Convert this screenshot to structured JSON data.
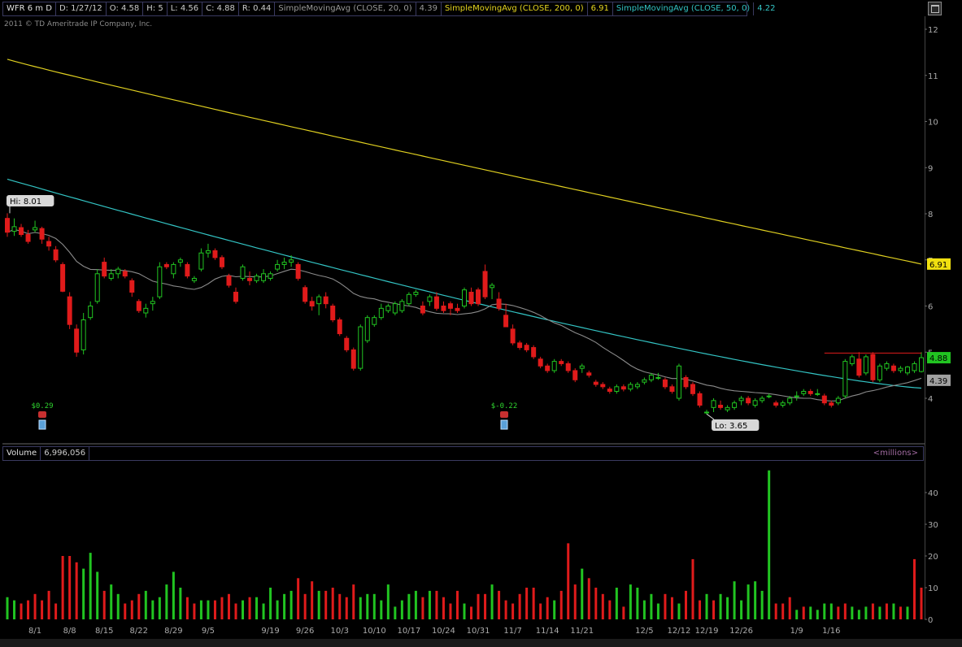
{
  "header": {
    "symbol": "WFR 6 m D",
    "date": "D: 1/27/12",
    "open": "O: 4.58",
    "high": "H: 5",
    "low": "L: 4.56",
    "close": "C: 4.88",
    "range": "R: 0.44",
    "sma20_label": "SimpleMovingAvg (CLOSE, 20, 0)",
    "sma20_value": "4.39",
    "sma200_label": "SimpleMovingAvg (CLOSE, 200, 0)",
    "sma200_value": "6.91",
    "sma50_label": "SimpleMovingAvg (CLOSE, 50, 0)",
    "sma50_value": "4.22"
  },
  "copyright": "2011 © TD Ameritrade IP Company, Inc.",
  "volume_header": {
    "label": "Volume",
    "value": "6,996,056",
    "units": "<millions>"
  },
  "colors": {
    "up": "#21c421",
    "down": "#e01b1b",
    "sma20": "#8a8a8a",
    "sma50": "#33c4c4",
    "sma200": "#e0d020",
    "neutral": "#b0b0b0"
  },
  "chart_data": [
    {
      "type": "candlestick",
      "title": "WFR 6 m D",
      "ylim": [
        3.2,
        12.3
      ],
      "y_ticks": [
        4,
        5,
        6,
        7,
        8,
        9,
        10,
        11,
        12
      ],
      "x_labels": [
        "8/1",
        "8/8",
        "8/15",
        "8/22",
        "8/29",
        "9/5",
        "9/19",
        "9/26",
        "10/3",
        "10/10",
        "10/17",
        "10/24",
        "10/31",
        "11/7",
        "11/14",
        "11/21",
        "12/5",
        "12/12",
        "12/19",
        "12/26",
        "1/9",
        "1/16"
      ],
      "x_label_index": [
        4,
        9,
        14,
        19,
        24,
        29,
        38,
        43,
        48,
        53,
        58,
        63,
        68,
        73,
        78,
        83,
        92,
        97,
        101,
        106,
        114,
        119
      ],
      "ohlc": [
        [
          7.9,
          8.01,
          7.5,
          7.6
        ],
        [
          7.62,
          7.9,
          7.52,
          7.72
        ],
        [
          7.7,
          7.78,
          7.5,
          7.55
        ],
        [
          7.55,
          7.65,
          7.35,
          7.4
        ],
        [
          7.65,
          7.85,
          7.6,
          7.7
        ],
        [
          7.68,
          7.72,
          7.35,
          7.45
        ],
        [
          7.4,
          7.5,
          7.2,
          7.3
        ],
        [
          7.22,
          7.3,
          6.95,
          7.0
        ],
        [
          6.9,
          6.95,
          6.3,
          6.32
        ],
        [
          6.2,
          6.3,
          5.5,
          5.6
        ],
        [
          5.5,
          5.6,
          4.9,
          5.0
        ],
        [
          5.05,
          5.85,
          4.95,
          5.7
        ],
        [
          5.75,
          6.1,
          5.7,
          6.0
        ],
        [
          6.1,
          6.8,
          6.05,
          6.7
        ],
        [
          6.95,
          7.05,
          6.6,
          6.65
        ],
        [
          6.6,
          6.8,
          6.55,
          6.7
        ],
        [
          6.7,
          6.85,
          6.6,
          6.8
        ],
        [
          6.75,
          6.8,
          6.6,
          6.65
        ],
        [
          6.55,
          6.6,
          6.2,
          6.3
        ],
        [
          6.1,
          6.15,
          5.85,
          5.9
        ],
        [
          5.85,
          6.05,
          5.75,
          5.95
        ],
        [
          6.05,
          6.2,
          5.9,
          6.1
        ],
        [
          6.2,
          6.95,
          6.15,
          6.85
        ],
        [
          6.9,
          6.95,
          6.8,
          6.85
        ],
        [
          6.7,
          6.95,
          6.6,
          6.9
        ],
        [
          6.95,
          7.05,
          6.85,
          7.0
        ],
        [
          6.9,
          6.95,
          6.6,
          6.65
        ],
        [
          6.55,
          6.65,
          6.5,
          6.6
        ],
        [
          6.8,
          7.25,
          6.75,
          7.15
        ],
        [
          7.15,
          7.35,
          7.05,
          7.2
        ],
        [
          7.2,
          7.25,
          7.0,
          7.05
        ],
        [
          7.05,
          7.1,
          6.8,
          6.85
        ],
        [
          6.65,
          6.7,
          6.4,
          6.45
        ],
        [
          6.3,
          6.4,
          6.05,
          6.1
        ],
        [
          6.6,
          6.9,
          6.55,
          6.85
        ],
        [
          6.6,
          6.75,
          6.45,
          6.55
        ],
        [
          6.55,
          6.7,
          6.5,
          6.65
        ],
        [
          6.55,
          6.8,
          6.5,
          6.7
        ],
        [
          6.6,
          6.75,
          6.55,
          6.7
        ],
        [
          6.8,
          7.0,
          6.75,
          6.9
        ],
        [
          6.9,
          7.05,
          6.8,
          6.95
        ],
        [
          6.95,
          7.1,
          6.85,
          7.0
        ],
        [
          6.9,
          6.95,
          6.55,
          6.6
        ],
        [
          6.4,
          6.45,
          6.05,
          6.1
        ],
        [
          6.1,
          6.2,
          5.9,
          6.0
        ],
        [
          6.05,
          6.25,
          5.8,
          6.2
        ],
        [
          6.2,
          6.3,
          5.95,
          6.05
        ],
        [
          6.0,
          6.05,
          5.65,
          5.7
        ],
        [
          5.7,
          5.75,
          5.35,
          5.4
        ],
        [
          5.3,
          5.35,
          5.0,
          5.05
        ],
        [
          5.05,
          5.1,
          4.6,
          4.65
        ],
        [
          4.65,
          5.6,
          4.6,
          5.55
        ],
        [
          5.25,
          5.8,
          5.2,
          5.75
        ],
        [
          5.6,
          5.8,
          5.55,
          5.75
        ],
        [
          5.75,
          6.05,
          5.7,
          5.95
        ],
        [
          5.9,
          6.05,
          5.85,
          6.0
        ],
        [
          5.85,
          6.1,
          5.8,
          6.05
        ],
        [
          5.9,
          6.15,
          5.85,
          6.1
        ],
        [
          6.05,
          6.3,
          6.0,
          6.25
        ],
        [
          6.25,
          6.35,
          6.2,
          6.3
        ],
        [
          6.0,
          6.1,
          5.8,
          5.85
        ],
        [
          6.1,
          6.25,
          6.0,
          6.2
        ],
        [
          6.2,
          6.3,
          5.9,
          5.95
        ],
        [
          6.0,
          6.1,
          5.85,
          5.9
        ],
        [
          6.05,
          6.1,
          5.8,
          5.95
        ],
        [
          5.95,
          6.05,
          5.85,
          5.9
        ],
        [
          6.0,
          6.4,
          5.95,
          6.35
        ],
        [
          6.3,
          6.4,
          6.0,
          6.05
        ],
        [
          6.35,
          6.4,
          6.0,
          6.05
        ],
        [
          6.75,
          6.9,
          6.15,
          6.2
        ],
        [
          6.4,
          6.5,
          6.15,
          6.45
        ],
        [
          6.15,
          6.3,
          5.9,
          5.95
        ],
        [
          5.8,
          6.05,
          5.55,
          5.55
        ],
        [
          5.5,
          5.6,
          5.15,
          5.2
        ],
        [
          5.2,
          5.25,
          5.05,
          5.1
        ],
        [
          5.15,
          5.2,
          5.0,
          5.05
        ],
        [
          5.1,
          5.15,
          4.85,
          4.9
        ],
        [
          4.85,
          4.9,
          4.65,
          4.7
        ],
        [
          4.7,
          4.75,
          4.55,
          4.6
        ],
        [
          4.6,
          4.85,
          4.55,
          4.8
        ],
        [
          4.8,
          4.85,
          4.7,
          4.75
        ],
        [
          4.75,
          4.8,
          4.55,
          4.6
        ],
        [
          4.6,
          4.65,
          4.35,
          4.4
        ],
        [
          4.65,
          4.75,
          4.55,
          4.7
        ],
        [
          4.55,
          4.6,
          4.45,
          4.5
        ],
        [
          4.35,
          4.4,
          4.25,
          4.3
        ],
        [
          4.3,
          4.35,
          4.2,
          4.25
        ],
        [
          4.2,
          4.25,
          4.1,
          4.15
        ],
        [
          4.15,
          4.3,
          4.1,
          4.25
        ],
        [
          4.25,
          4.3,
          4.15,
          4.2
        ],
        [
          4.2,
          4.35,
          4.15,
          4.3
        ],
        [
          4.25,
          4.35,
          4.2,
          4.3
        ],
        [
          4.35,
          4.45,
          4.3,
          4.4
        ],
        [
          4.4,
          4.55,
          4.35,
          4.5
        ],
        [
          4.45,
          4.55,
          4.4,
          4.45
        ],
        [
          4.4,
          4.45,
          4.2,
          4.25
        ],
        [
          4.25,
          4.3,
          4.1,
          4.15
        ],
        [
          4.0,
          4.75,
          3.95,
          4.7
        ],
        [
          4.45,
          4.5,
          4.2,
          4.25
        ],
        [
          4.3,
          4.35,
          4.05,
          4.1
        ],
        [
          4.1,
          4.15,
          3.8,
          3.85
        ],
        [
          3.7,
          3.75,
          3.65,
          3.7
        ],
        [
          3.8,
          4.0,
          3.7,
          3.95
        ],
        [
          3.85,
          3.95,
          3.75,
          3.8
        ],
        [
          3.75,
          3.85,
          3.7,
          3.8
        ],
        [
          3.8,
          3.95,
          3.75,
          3.9
        ],
        [
          3.95,
          4.05,
          3.85,
          4.0
        ],
        [
          4.0,
          4.05,
          3.85,
          3.9
        ],
        [
          3.85,
          4.0,
          3.8,
          3.95
        ],
        [
          3.95,
          4.05,
          3.9,
          4.0
        ],
        [
          4.05,
          4.1,
          4.0,
          4.05
        ],
        [
          3.9,
          3.95,
          3.8,
          3.85
        ],
        [
          3.85,
          3.95,
          3.8,
          3.9
        ],
        [
          3.9,
          4.05,
          3.85,
          4.0
        ],
        [
          4.05,
          4.15,
          3.95,
          4.05
        ],
        [
          4.1,
          4.2,
          4.05,
          4.15
        ],
        [
          4.15,
          4.2,
          4.05,
          4.1
        ],
        [
          4.1,
          4.2,
          4.05,
          4.1
        ],
        [
          4.05,
          4.1,
          3.85,
          3.9
        ],
        [
          3.9,
          3.95,
          3.8,
          3.85
        ],
        [
          3.9,
          4.05,
          3.85,
          4.0
        ],
        [
          4.05,
          4.85,
          4.0,
          4.8
        ],
        [
          4.75,
          4.95,
          4.7,
          4.9
        ],
        [
          4.85,
          5.0,
          4.45,
          4.5
        ],
        [
          4.55,
          4.95,
          4.5,
          4.9
        ],
        [
          4.95,
          5.0,
          4.35,
          4.4
        ],
        [
          4.4,
          4.75,
          4.35,
          4.7
        ],
        [
          4.65,
          4.8,
          4.6,
          4.75
        ],
        [
          4.7,
          4.75,
          4.55,
          4.6
        ],
        [
          4.6,
          4.7,
          4.55,
          4.65
        ],
        [
          4.55,
          4.7,
          4.5,
          4.68
        ],
        [
          4.6,
          4.8,
          4.55,
          4.75
        ],
        [
          4.58,
          5.0,
          4.56,
          4.88
        ]
      ],
      "sma200": {
        "start": 11.35,
        "end": 6.91
      },
      "sma50": {
        "start": 8.75,
        "end": 4.22
      },
      "sma20_value": 4.39,
      "price_labels": {
        "last": "4.88",
        "sma20": "4.39",
        "sma200": "6.91"
      },
      "annotations": {
        "high": "Hi: 8.01",
        "low": "Lo: 3.65",
        "event1": "$0.29",
        "event2": "$-0.22"
      }
    },
    {
      "type": "bar",
      "title": "Volume",
      "ylabel": "<millions>",
      "ylim": [
        0,
        48
      ],
      "y_ticks": [
        0,
        10,
        20,
        30,
        40
      ],
      "values": [
        7,
        6,
        5,
        6,
        8,
        6,
        9,
        5,
        20,
        20,
        18,
        16,
        21,
        15,
        9,
        11,
        8,
        5,
        6,
        8,
        9,
        6,
        7,
        11,
        15,
        10,
        7,
        5,
        6,
        6,
        6,
        7,
        8,
        5,
        6,
        7,
        7,
        5,
        10,
        6,
        8,
        9,
        13,
        8,
        12,
        9,
        9,
        10,
        8,
        7,
        11,
        7,
        8,
        8,
        6,
        11,
        4,
        6,
        8,
        9,
        7,
        9,
        9,
        7,
        5,
        9,
        5,
        4,
        8,
        8,
        11,
        9,
        6,
        5,
        8,
        10,
        10,
        5,
        7,
        6,
        9,
        24,
        11,
        16,
        13,
        10,
        8,
        6,
        10,
        4,
        11,
        10,
        6,
        8,
        5,
        8,
        7,
        5,
        9,
        19,
        6,
        8,
        6,
        8,
        7,
        12,
        6,
        11,
        12,
        9,
        47,
        5,
        5,
        7,
        3,
        4,
        4,
        3,
        5,
        5,
        4,
        5,
        4,
        3,
        4,
        5,
        4,
        5,
        5,
        4,
        4,
        19,
        10,
        8,
        14,
        9,
        7,
        8,
        6,
        7
      ],
      "up": [
        1,
        1,
        0,
        0,
        0,
        0,
        0,
        0,
        0,
        0,
        0,
        1,
        1,
        1,
        0,
        1,
        1,
        0,
        0,
        0,
        1,
        1,
        1,
        1,
        1,
        1,
        0,
        0,
        1,
        1,
        0,
        0,
        0,
        0,
        1,
        0,
        1,
        1,
        1,
        1,
        1,
        1,
        0,
        0,
        0,
        1,
        0,
        0,
        0,
        0,
        0,
        1,
        1,
        1,
        1,
        1,
        1,
        1,
        1,
        1,
        0,
        1,
        0,
        0,
        0,
        0,
        1,
        0,
        0,
        0,
        1,
        0,
        0,
        0,
        0,
        0,
        0,
        0,
        0,
        1,
        0,
        0,
        0,
        1,
        0,
        0,
        0,
        0,
        1,
        0,
        1,
        1,
        1,
        1,
        1,
        0,
        0,
        1,
        0,
        0,
        0,
        1,
        0,
        1,
        1,
        1,
        1,
        1,
        1,
        1,
        1,
        0,
        0,
        0,
        1,
        0,
        1,
        1,
        1,
        1,
        0,
        0,
        1,
        1,
        1,
        0,
        1,
        0,
        1,
        0,
        1,
        0,
        0,
        1,
        1,
        1,
        1,
        1,
        1,
        1,
        1
      ]
    }
  ]
}
